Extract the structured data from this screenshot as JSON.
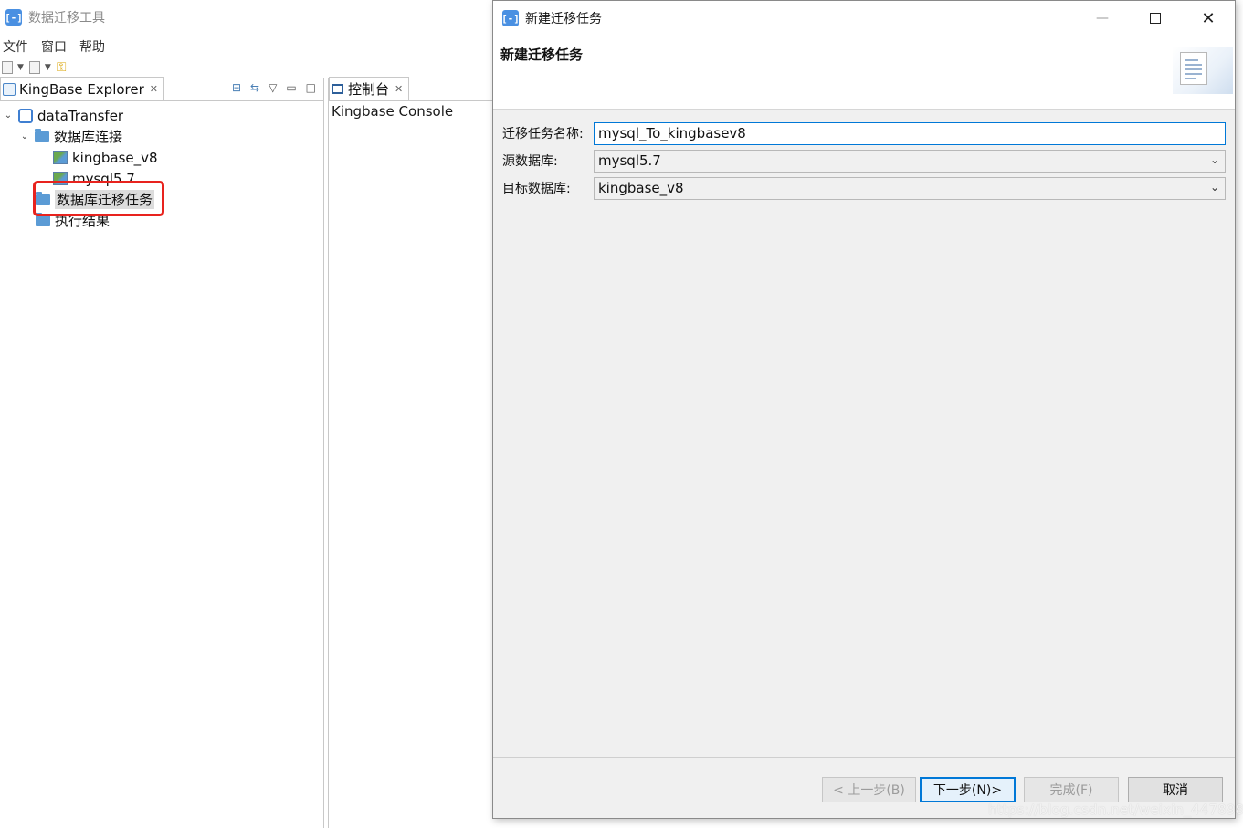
{
  "main_window": {
    "title": "数据迁移工具",
    "menu": [
      "文件",
      "窗口",
      "帮助"
    ]
  },
  "explorer": {
    "tab_label": "KingBase Explorer",
    "tree": {
      "root": "dataTransfer",
      "connections_folder": "数据库连接",
      "connections": [
        "kingbase_v8",
        "mysql5.7"
      ],
      "migration_folder": "数据库迁移任务",
      "results_folder": "执行结果"
    }
  },
  "console": {
    "tab_label": "控制台",
    "title": "Kingbase Console"
  },
  "dialog": {
    "title": "新建迁移任务",
    "heading": "新建迁移任务",
    "fields": {
      "task_name_label": "迁移任务名称:",
      "task_name_value": "mysql_To_kingbasev8",
      "source_label": "源数据库:",
      "source_value": "mysql5.7",
      "target_label": "目标数据库:",
      "target_value": "kingbase_v8"
    },
    "buttons": {
      "back": "< 上一步(B)",
      "next": "下一步(N)>",
      "finish": "完成(F)",
      "cancel": "取消"
    }
  },
  "watermark": "https://blog.csdn.net/weixin_44789863",
  "colors": {
    "accent": "#0078d7",
    "highlight_border": "#e8231e",
    "folder": "#5b9bd5"
  }
}
